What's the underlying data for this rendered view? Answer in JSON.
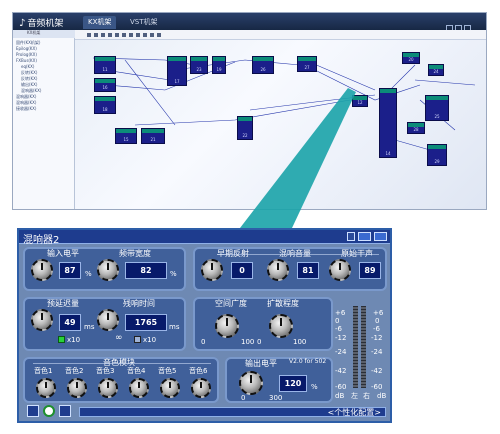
{
  "host": {
    "title_icon": "music-note-icon",
    "title": "音频机架",
    "tabs": [
      "KX机架",
      "VST机架"
    ],
    "tree_header": "KX机架",
    "tree_items": [
      "固件(KX机架)",
      "Epilog(KX)",
      "Prolog(KX)",
      "FXBus(KX)",
      "eq(KX)",
      "反转(KX)",
      "反转(KX)",
      "输出(KX)",
      "混响器(KX)",
      "混响器(KX)",
      "混响器(KX)",
      "接收器(KX)"
    ],
    "block_numbers": [
      "11",
      "16",
      "18",
      "17",
      "23",
      "19",
      "26",
      "27",
      "15",
      "21",
      "22",
      "12",
      "14",
      "20",
      "24",
      "25",
      "28",
      "29"
    ]
  },
  "panel": {
    "title": "混响器2",
    "colors": {
      "bg": "#6e89b3",
      "title": "#1e3c8e",
      "display": "#071a6a",
      "led": "#28d33a"
    },
    "input_level": {
      "label": "输入电平",
      "value": "87",
      "unit": "%"
    },
    "bandwidth": {
      "label": "频带宽度",
      "value": "82",
      "unit": "%"
    },
    "early_reflection": {
      "label": "早期反射",
      "value": "0"
    },
    "reverb_volume": {
      "label": "混响音量",
      "value": "81"
    },
    "dry_sound": {
      "label": "原始干声",
      "value": "89"
    },
    "predelay": {
      "label": "预延迟量",
      "value": "49",
      "unit": "ms",
      "range": "x10"
    },
    "decay_time": {
      "label": "残响时间",
      "value": "1765",
      "unit": "ms",
      "range": "x10",
      "infinity": "∞"
    },
    "room_width": {
      "label": "空间广度",
      "min": "0",
      "max": "100"
    },
    "diffusion": {
      "label": "扩散程度",
      "min": "0",
      "max": "100"
    },
    "tone": {
      "label": "音色模块",
      "knobs": [
        "音色1",
        "音色2",
        "音色3",
        "音色4",
        "音色5",
        "音色6"
      ]
    },
    "output_level": {
      "label": "输出电平",
      "version": "V2.0 for 502",
      "value": "120",
      "unit": "%",
      "min": "0",
      "max": "300"
    },
    "meter": {
      "scale_left": [
        "+6",
        "0",
        "-6",
        "-12",
        "-24",
        "-42",
        "-60",
        "dB"
      ],
      "scale_right": [
        "+6",
        "0",
        "-6",
        "-12",
        "-24",
        "-42",
        "-60",
        "dB"
      ],
      "ch_left": "左",
      "ch_right": "右"
    },
    "preset": "<个性化配置>"
  }
}
